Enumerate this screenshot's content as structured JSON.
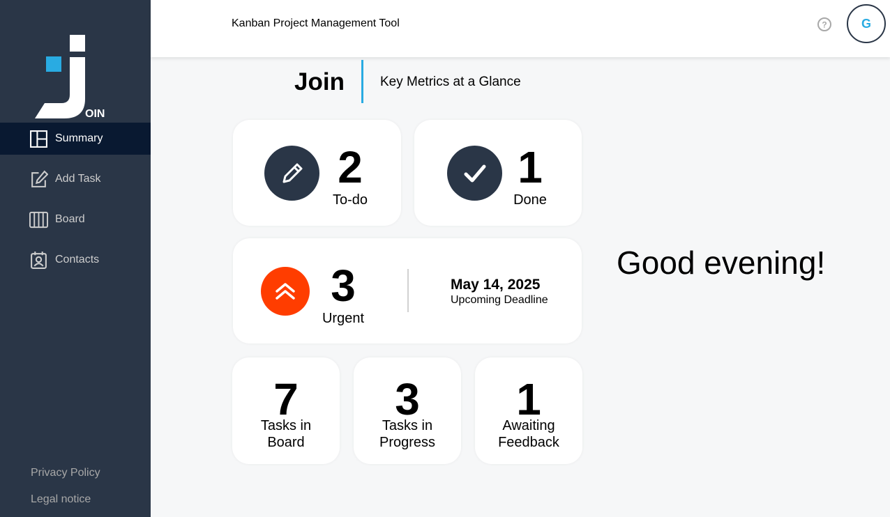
{
  "sidebar": {
    "logo_text": "OIN",
    "items": [
      {
        "label": "Summary",
        "icon": "summary-icon",
        "active": true
      },
      {
        "label": "Add Task",
        "icon": "add-task-icon"
      },
      {
        "label": "Board",
        "icon": "board-icon"
      },
      {
        "label": "Contacts",
        "icon": "contacts-icon"
      }
    ],
    "footer": [
      "Privacy Policy",
      "Legal notice"
    ]
  },
  "header": {
    "title": "Kanban Project Management Tool",
    "help_icon": "help-icon",
    "avatar_initial": "G"
  },
  "page": {
    "title": "Join",
    "subtitle": "Key Metrics at a Glance",
    "greeting": "Good evening!"
  },
  "metrics": {
    "todo": {
      "value": "2",
      "label": "To-do"
    },
    "done": {
      "value": "1",
      "label": "Done"
    },
    "urgent": {
      "value": "3",
      "label": "Urgent",
      "deadline_date": "May 14, 2025",
      "deadline_label": "Upcoming Deadline"
    },
    "board": {
      "value": "7",
      "label": "Tasks in Board"
    },
    "progress": {
      "value": "3",
      "label": "Tasks in Progress"
    },
    "feedback": {
      "value": "1",
      "label": "Awaiting Feedback"
    }
  },
  "colors": {
    "sidebar": "#2a3647",
    "sidebar_active": "#091931",
    "accent": "#29abe2",
    "urgent": "#ff3d00"
  }
}
